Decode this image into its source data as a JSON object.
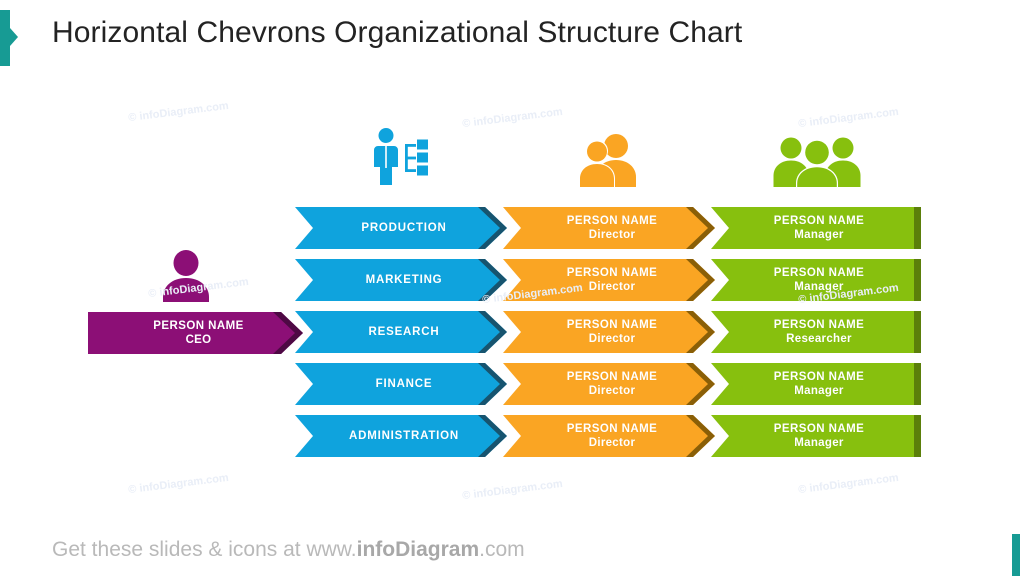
{
  "slide": {
    "title": "Horizontal Chevrons Organizational Structure Chart",
    "accent_color": "#179b94",
    "background": "#ffffff"
  },
  "colors": {
    "blue": "#0fa3dd",
    "blue_shadow": "#17546f",
    "orange": "#faa523",
    "orange_shadow": "#8a5f07",
    "green": "#87c00e",
    "green_shadow": "#5b7f0a",
    "purple": "#8c0f76",
    "purple_shadow": "#4e0944",
    "teal": "#179b94"
  },
  "icons": {
    "ceo": {
      "name": "single-person-icon",
      "color": "#8c0f76"
    },
    "column_blue": {
      "name": "person-org-chart-icon",
      "color": "#0fa3dd"
    },
    "column_orange": {
      "name": "two-people-icon",
      "color": "#faa523"
    },
    "column_green": {
      "name": "three-people-group-icon",
      "color": "#87c00e"
    }
  },
  "ceo": {
    "name": "PERSON NAME",
    "role": "CEO"
  },
  "rows": [
    {
      "department": "PRODUCTION",
      "manager": {
        "name": "PERSON NAME",
        "role": "Director"
      },
      "staff": {
        "name": "PERSON NAME",
        "role": "Manager"
      }
    },
    {
      "department": "MARKETING",
      "manager": {
        "name": "PERSON NAME",
        "role": "Director"
      },
      "staff": {
        "name": "PERSON NAME",
        "role": "Manager"
      }
    },
    {
      "department": "RESEARCH",
      "manager": {
        "name": "PERSON NAME",
        "role": "Director"
      },
      "staff": {
        "name": "PERSON NAME",
        "role": "Researcher"
      }
    },
    {
      "department": "FINANCE",
      "manager": {
        "name": "PERSON NAME",
        "role": "Director"
      },
      "staff": {
        "name": "PERSON NAME",
        "role": "Manager"
      }
    },
    {
      "department": "ADMINISTRATION",
      "manager": {
        "name": "PERSON NAME",
        "role": "Director"
      },
      "staff": {
        "name": "PERSON NAME",
        "role": "Manager"
      }
    }
  ],
  "watermark": {
    "text": "© infoDiagram.com"
  },
  "footer": {
    "prefix": "Get these slides & icons at www.",
    "brand": "infoDiagram",
    "suffix": ".com"
  }
}
